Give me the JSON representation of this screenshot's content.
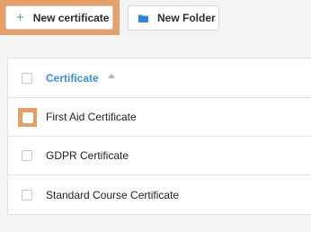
{
  "toolbar": {
    "new_certificate_label": "New certificate",
    "new_certificate_icon": "plus-icon",
    "new_folder_label": "New Folder",
    "new_folder_icon": "folder-icon"
  },
  "table": {
    "header": {
      "column_label": "Certificate",
      "sort_icon": "chevron-up-icon"
    },
    "rows": [
      {
        "name": "First Aid Certificate",
        "checked": false
      },
      {
        "name": "GDPR Certificate",
        "checked": false
      },
      {
        "name": "Standard Course Certificate",
        "checked": false
      }
    ]
  },
  "colors": {
    "accent_blue": "#3b8fd6",
    "highlight_orange": "#e3a06b",
    "plus_green": "#5aa85a"
  }
}
